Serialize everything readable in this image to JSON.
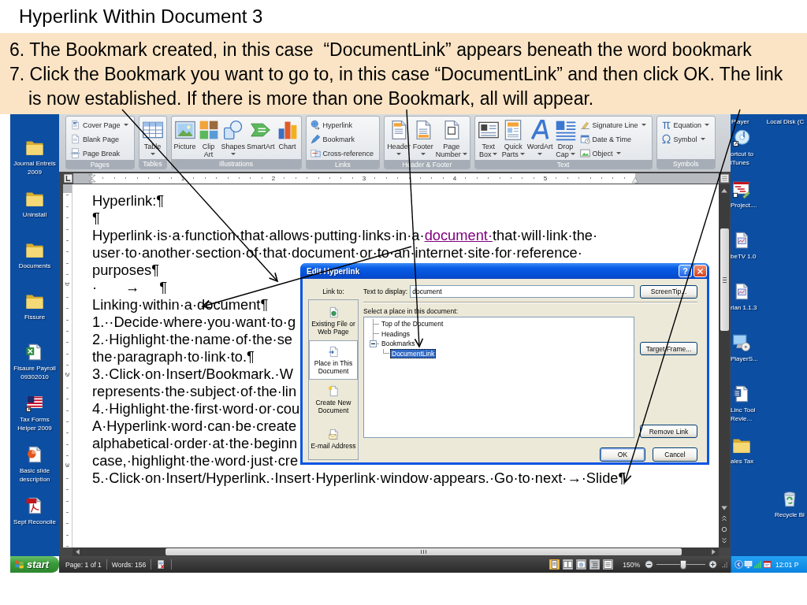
{
  "slide": {
    "title": "Hyperlink Within Document 3"
  },
  "callout": {
    "steps": [
      "6. The Bookmark created, in this case  “DocumentLink” appears beneath the word bookmark",
      "7. Click the Bookmark you want to go to, in this case “DocumentLink” and then click OK. The link\nis now established. If there is more than one Bookmark, all will appear."
    ]
  },
  "desktop_left": {
    "icons": [
      {
        "label": "Journal Entreis 2009"
      },
      {
        "label": "Uninstall"
      },
      {
        "label": "Documents"
      },
      {
        "label": "Fissure"
      },
      {
        "label": "Fisaure Payroll 09302010"
      },
      {
        "label": "Tax Forms Helper 2009"
      },
      {
        "label": "Basic slide description"
      },
      {
        "label": "Sept Reconcile"
      }
    ]
  },
  "word": {
    "ribbon": {
      "groups": [
        {
          "label": "Pages",
          "items": [
            {
              "label": "Cover Page",
              "kind": "small",
              "dropdown": true
            },
            {
              "label": "Blank Page",
              "kind": "small",
              "dropdown": false
            },
            {
              "label": "Page Break",
              "kind": "small",
              "dropdown": false
            }
          ]
        },
        {
          "label": "Tables",
          "items": [
            {
              "label": "Table",
              "kind": "large",
              "dropdown": true
            }
          ]
        },
        {
          "label": "Illustrations",
          "items": [
            {
              "label": "Picture",
              "kind": "large",
              "dropdown": false
            },
            {
              "label": "Clip Art",
              "kind": "large",
              "dropdown": false
            },
            {
              "label": "Shapes",
              "kind": "large",
              "dropdown": true
            },
            {
              "label": "SmartArt",
              "kind": "large",
              "dropdown": false
            },
            {
              "label": "Chart",
              "kind": "large",
              "dropdown": false
            }
          ]
        },
        {
          "label": "Links",
          "items": [
            {
              "label": "Hyperlink",
              "kind": "small",
              "dropdown": false
            },
            {
              "label": "Bookmark",
              "kind": "small",
              "dropdown": false
            },
            {
              "label": "Cross-reference",
              "kind": "small",
              "dropdown": false
            }
          ]
        },
        {
          "label": "Header & Footer",
          "items": [
            {
              "label": "Header",
              "kind": "large",
              "dropdown": true
            },
            {
              "label": "Footer",
              "kind": "large",
              "dropdown": true
            },
            {
              "label": "Page Number",
              "kind": "large",
              "dropdown": true
            }
          ]
        },
        {
          "label": "Text",
          "items": [
            {
              "label": "Text Box",
              "kind": "large",
              "dropdown": true
            },
            {
              "label": "Quick Parts",
              "kind": "large",
              "dropdown": true
            },
            {
              "label": "WordArt",
              "kind": "large",
              "dropdown": true
            },
            {
              "label": "Drop Cap",
              "kind": "large",
              "dropdown": true
            },
            {
              "label": "Signature Line",
              "kind": "small",
              "dropdown": true
            },
            {
              "label": "Date & Time",
              "kind": "small",
              "dropdown": false
            },
            {
              "label": "Object",
              "kind": "small",
              "dropdown": true
            }
          ]
        },
        {
          "label": "Symbols",
          "items": [
            {
              "label": "Equation",
              "kind": "small",
              "dropdown": true
            },
            {
              "label": "Symbol",
              "kind": "small",
              "dropdown": true
            }
          ]
        }
      ]
    },
    "ruler": {
      "labels": [
        "1",
        "2",
        "3",
        "4",
        "5"
      ]
    },
    "vertical_ruler": {
      "labels": [
        "1",
        "2",
        "3"
      ]
    },
    "document": {
      "lines": [
        {
          "parts": [
            {
              "kind": "text",
              "text": "Hyperlink:¶"
            }
          ]
        },
        {
          "parts": [
            {
              "kind": "text",
              "text": "¶"
            }
          ]
        },
        {
          "parts": [
            {
              "kind": "text",
              "text": "Hyperlink·is·a·function·that·allows·putting·links·in·a·"
            },
            {
              "kind": "link",
              "text": "document·"
            },
            {
              "kind": "text",
              "text": "that·will·link·the·"
            }
          ]
        },
        {
          "parts": [
            {
              "kind": "text",
              "text": "user·to·another·section·of·that·document·or·to·an·internet·site·for·reference·"
            }
          ]
        },
        {
          "parts": [
            {
              "kind": "text",
              "text": "purposes¶"
            }
          ]
        },
        {
          "parts": [
            {
              "kind": "text",
              "text": "·       →     ¶"
            }
          ]
        },
        {
          "parts": [
            {
              "kind": "text",
              "text": "Linking·within·a·document¶"
            }
          ]
        },
        {
          "parts": [
            {
              "kind": "text",
              "text": "1.··Decide·where·you·want·to·g"
            }
          ]
        },
        {
          "parts": [
            {
              "kind": "text",
              "text": "2.·Highlight·the·name·of·the·se"
            }
          ]
        },
        {
          "parts": [
            {
              "kind": "text",
              "text": "the·paragraph·to·link·to.¶"
            }
          ]
        },
        {
          "parts": [
            {
              "kind": "text",
              "text": "3.·Click·on·Insert/Bookmark.·W"
            }
          ]
        },
        {
          "parts": [
            {
              "kind": "text",
              "text": "represents·the·subject·of·the·lin"
            }
          ]
        },
        {
          "parts": [
            {
              "kind": "text",
              "text": "4.·Highlight·the·first·word·or·cou"
            }
          ]
        },
        {
          "parts": [
            {
              "kind": "text",
              "text": "A·Hyperlink·word·can·be·create"
            }
          ]
        },
        {
          "parts": [
            {
              "kind": "text",
              "text": "alphabetical·order·at·the·beginn"
            }
          ]
        },
        {
          "parts": [
            {
              "kind": "text",
              "text": "case,·highlight·the·word·just·cre"
            }
          ]
        },
        {
          "parts": [
            {
              "kind": "text",
              "text": "5.·Click·on·Insert/Hyperlink.·Insert·Hyperlink·window·appears.·Go·to·next·→·Slide¶"
            }
          ]
        }
      ]
    },
    "dialog": {
      "title": "Edit Hyperlink",
      "help_button": "?",
      "link_to_label": "Link to:",
      "link_to": [
        {
          "label": "Existing File or Web Page",
          "selected": false
        },
        {
          "label": "Place in This Document",
          "selected": true
        },
        {
          "label": "Create New Document",
          "selected": false
        },
        {
          "label": "E-mail Address",
          "selected": false
        }
      ],
      "text_to_display": {
        "label": "Text to display:",
        "value": "document"
      },
      "place_label": "Select a place in this document:",
      "tree": [
        {
          "label": "Top of the Document",
          "selected": false
        },
        {
          "label": "Headings",
          "selected": false
        },
        {
          "label": "Bookmarks",
          "selected": false,
          "expanded": true,
          "children": [
            {
              "label": "DocumentLink",
              "selected": true
            }
          ]
        }
      ],
      "buttons": {
        "screentip": "ScreenTip...",
        "target_frame": "Target Frame...",
        "remove_link": "Remove Link",
        "ok": "OK",
        "cancel": "Cancel"
      }
    },
    "status_bar": {
      "page": "Page: 1 of 1",
      "words": "Words: 156",
      "views": [
        {
          "selected": true
        },
        {
          "selected": false
        },
        {
          "selected": false
        },
        {
          "selected": false
        },
        {
          "selected": false
        }
      ],
      "zoom": "150%",
      "zoom_slider": {
        "level": 0.55
      }
    }
  },
  "desktop_right": {
    "top_labels": [
      "Player",
      "Local Disk (C"
    ],
    "icons": [
      {
        "label": "ortcut to iTunes"
      },
      {
        "label": "Project...."
      },
      {
        "label": "beTV 1.0"
      },
      {
        "label": "rian 1.1.3"
      },
      {
        "label": "PlayerS..."
      },
      {
        "label": "Linc Tool Revie..."
      },
      {
        "label": "ales Tax"
      }
    ],
    "recycle_bin": {
      "label": "Recycle Bi"
    }
  },
  "taskbar": {
    "start_label": "start",
    "clock": "12:01 P"
  }
}
